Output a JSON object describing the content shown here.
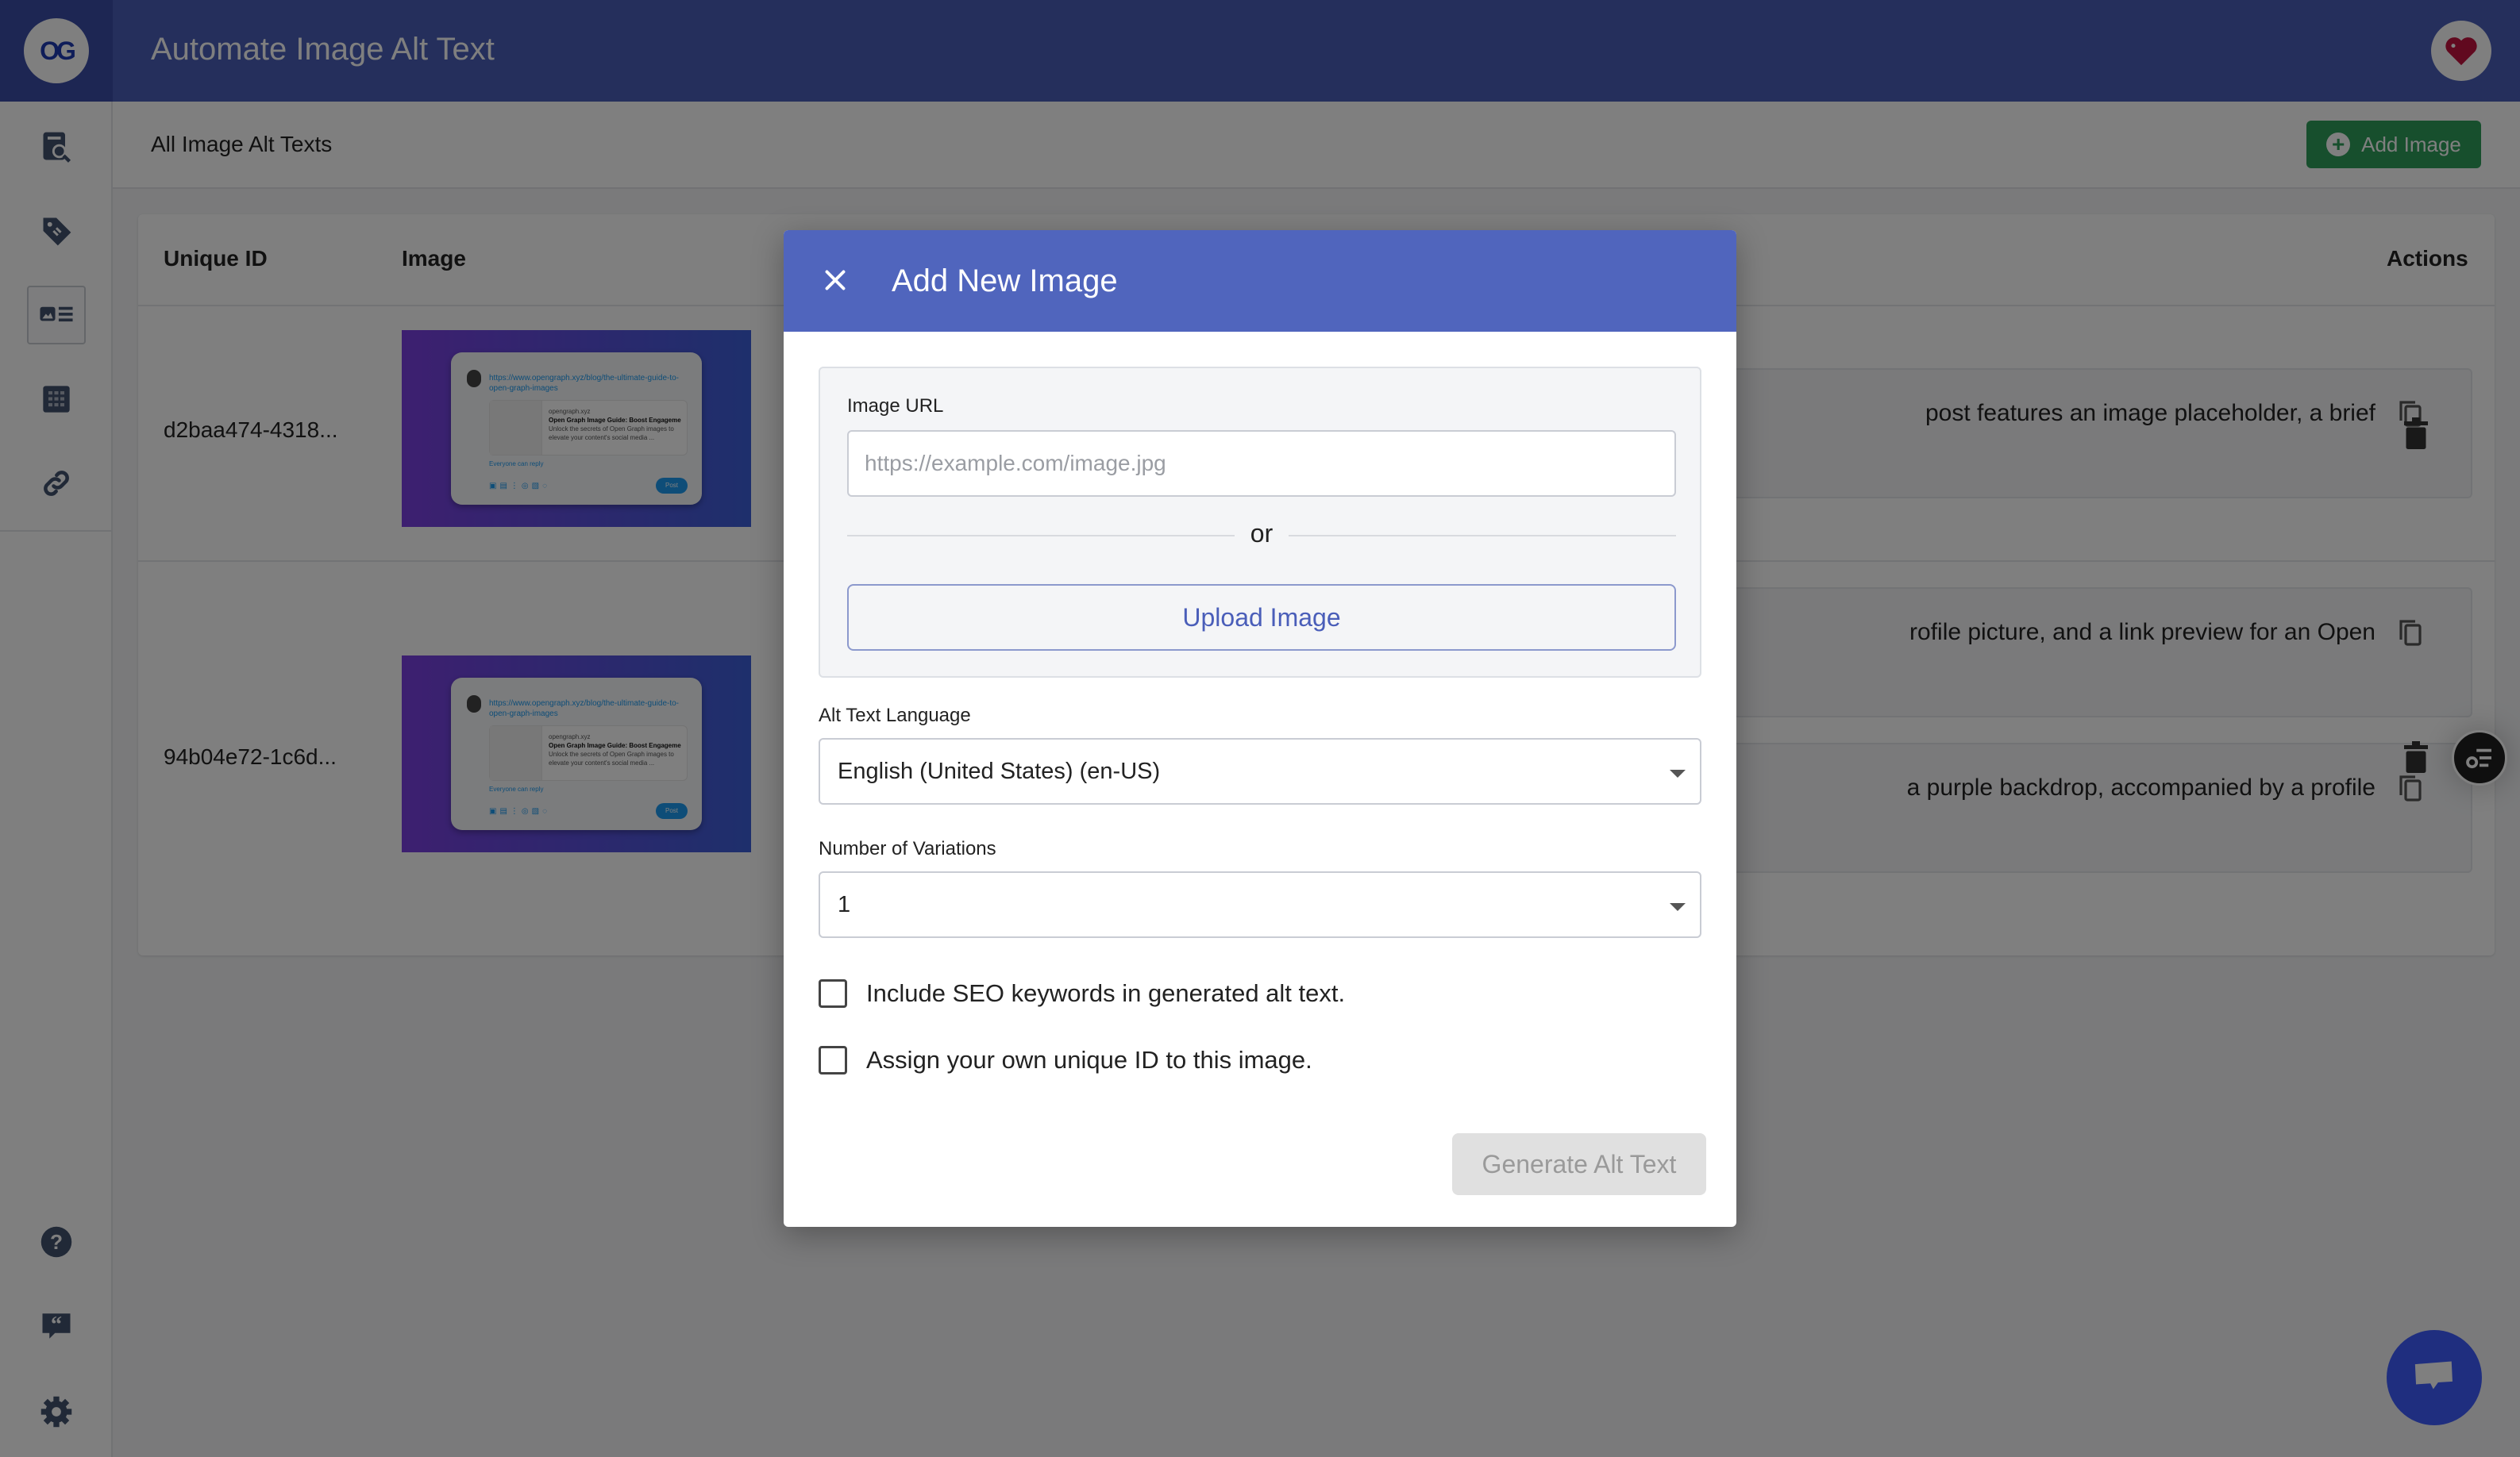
{
  "app": {
    "title": "Automate Image Alt Text",
    "logo_text": "OG"
  },
  "sidebar": {
    "items": [
      {
        "name": "search-report",
        "icon": "document-search-icon",
        "active": false
      },
      {
        "name": "tags",
        "icon": "tag-icon",
        "active": false
      },
      {
        "name": "image-alt-text",
        "icon": "image-list-icon",
        "active": true
      },
      {
        "name": "grid",
        "icon": "grid-icon",
        "active": false
      },
      {
        "name": "links",
        "icon": "link-icon",
        "active": false
      }
    ],
    "bottom_items": [
      {
        "name": "help",
        "icon": "help-icon"
      },
      {
        "name": "feedback",
        "icon": "quote-bubble-icon"
      },
      {
        "name": "settings",
        "icon": "gear-icon"
      }
    ]
  },
  "page": {
    "heading": "All Image Alt Texts",
    "add_image_label": "Add Image"
  },
  "table": {
    "columns": [
      "Unique ID",
      "Image",
      "Actions"
    ],
    "rows": [
      {
        "id": "d2baa474-4318...",
        "image": {
          "url_text": "https://www.opengraph.xyz/blog/the-ultimate-guide-to-open-graph-images",
          "site": "opengraph.xyz",
          "title": "Open Graph Image Guide: Boost Engageme",
          "desc": "Unlock the secrets of Open Graph images to elevate your content's social media ...",
          "reply": "Everyone can reply",
          "post": "Post"
        },
        "alt_texts": [
          "post features an image placeholder, a brief"
        ]
      },
      {
        "id": "94b04e72-1c6d...",
        "image": {
          "url_text": "https://www.opengraph.xyz/blog/the-ultimate-guide-to-open-graph-images",
          "site": "opengraph.xyz",
          "title": "Open Graph Image Guide: Boost Engageme",
          "desc": "Unlock the secrets of Open Graph images to elevate your content's social media ...",
          "reply": "Everyone can reply",
          "post": "Post"
        },
        "alt_texts": [
          "rofile picture, and a link preview for an Open",
          "a purple backdrop, accompanied by a profile"
        ]
      }
    ]
  },
  "modal": {
    "title": "Add New Image",
    "image_url_label": "Image URL",
    "image_url_placeholder": "https://example.com/image.jpg",
    "image_url_value": "",
    "or_text": "or",
    "upload_label": "Upload Image",
    "language_label": "Alt Text Language",
    "language_value": "English (United States) (en-US)",
    "variations_label": "Number of Variations",
    "variations_value": "1",
    "checkboxes": [
      {
        "label": "Include SEO keywords in generated alt text.",
        "checked": false
      },
      {
        "label": "Assign your own unique ID to this image.",
        "checked": false
      }
    ],
    "generate_label": "Generate Alt Text"
  },
  "colors": {
    "header": "#4b5fb8",
    "modal_header": "#5065bd",
    "add_button": "#2f9e5b",
    "chat_button": "#3e5cff"
  }
}
